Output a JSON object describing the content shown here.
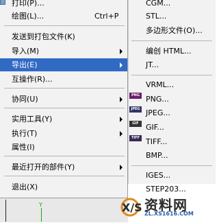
{
  "menu": {
    "items": [
      {
        "label": "打印(P)..."
      },
      {
        "label": "绘图(L)...",
        "shortcut": "Ctrl+P"
      },
      {
        "label": "发送到打包文件(K)"
      },
      {
        "label": "导入(M)"
      },
      {
        "label": "导出(E)"
      },
      {
        "label": "互操作(R)..."
      },
      {
        "label": "协同(U)"
      },
      {
        "label": "实用工具(Y)"
      },
      {
        "label": "执行(T)"
      },
      {
        "label": "属性(I)"
      },
      {
        "label": "最近打开的部件(Y)"
      },
      {
        "label": "退出(X)"
      }
    ]
  },
  "submenu": {
    "items": [
      {
        "label": "CGM..."
      },
      {
        "label": "STL..."
      },
      {
        "label": "多边形文件(O)..."
      },
      {
        "label": "编创 HTML..."
      },
      {
        "label": "JT..."
      },
      {
        "label": "VRML..."
      },
      {
        "label": "PNG...",
        "badge": "PNG"
      },
      {
        "label": "JPEG...",
        "badge": "JPEG"
      },
      {
        "label": "GIF...",
        "badge": "GIF"
      },
      {
        "label": "TIFF...",
        "badge": "TIFF"
      },
      {
        "label": "BMP..."
      },
      {
        "label": "IGES..."
      },
      {
        "label": "STEP203..."
      }
    ]
  },
  "viewport": {
    "axis_label": "Y"
  },
  "watermark": {
    "text": "资料网",
    "url": "ZL.XS1616.COM"
  },
  "colors": {
    "highlight": "#316ac5",
    "menu_bg": "#f2f2f2"
  }
}
